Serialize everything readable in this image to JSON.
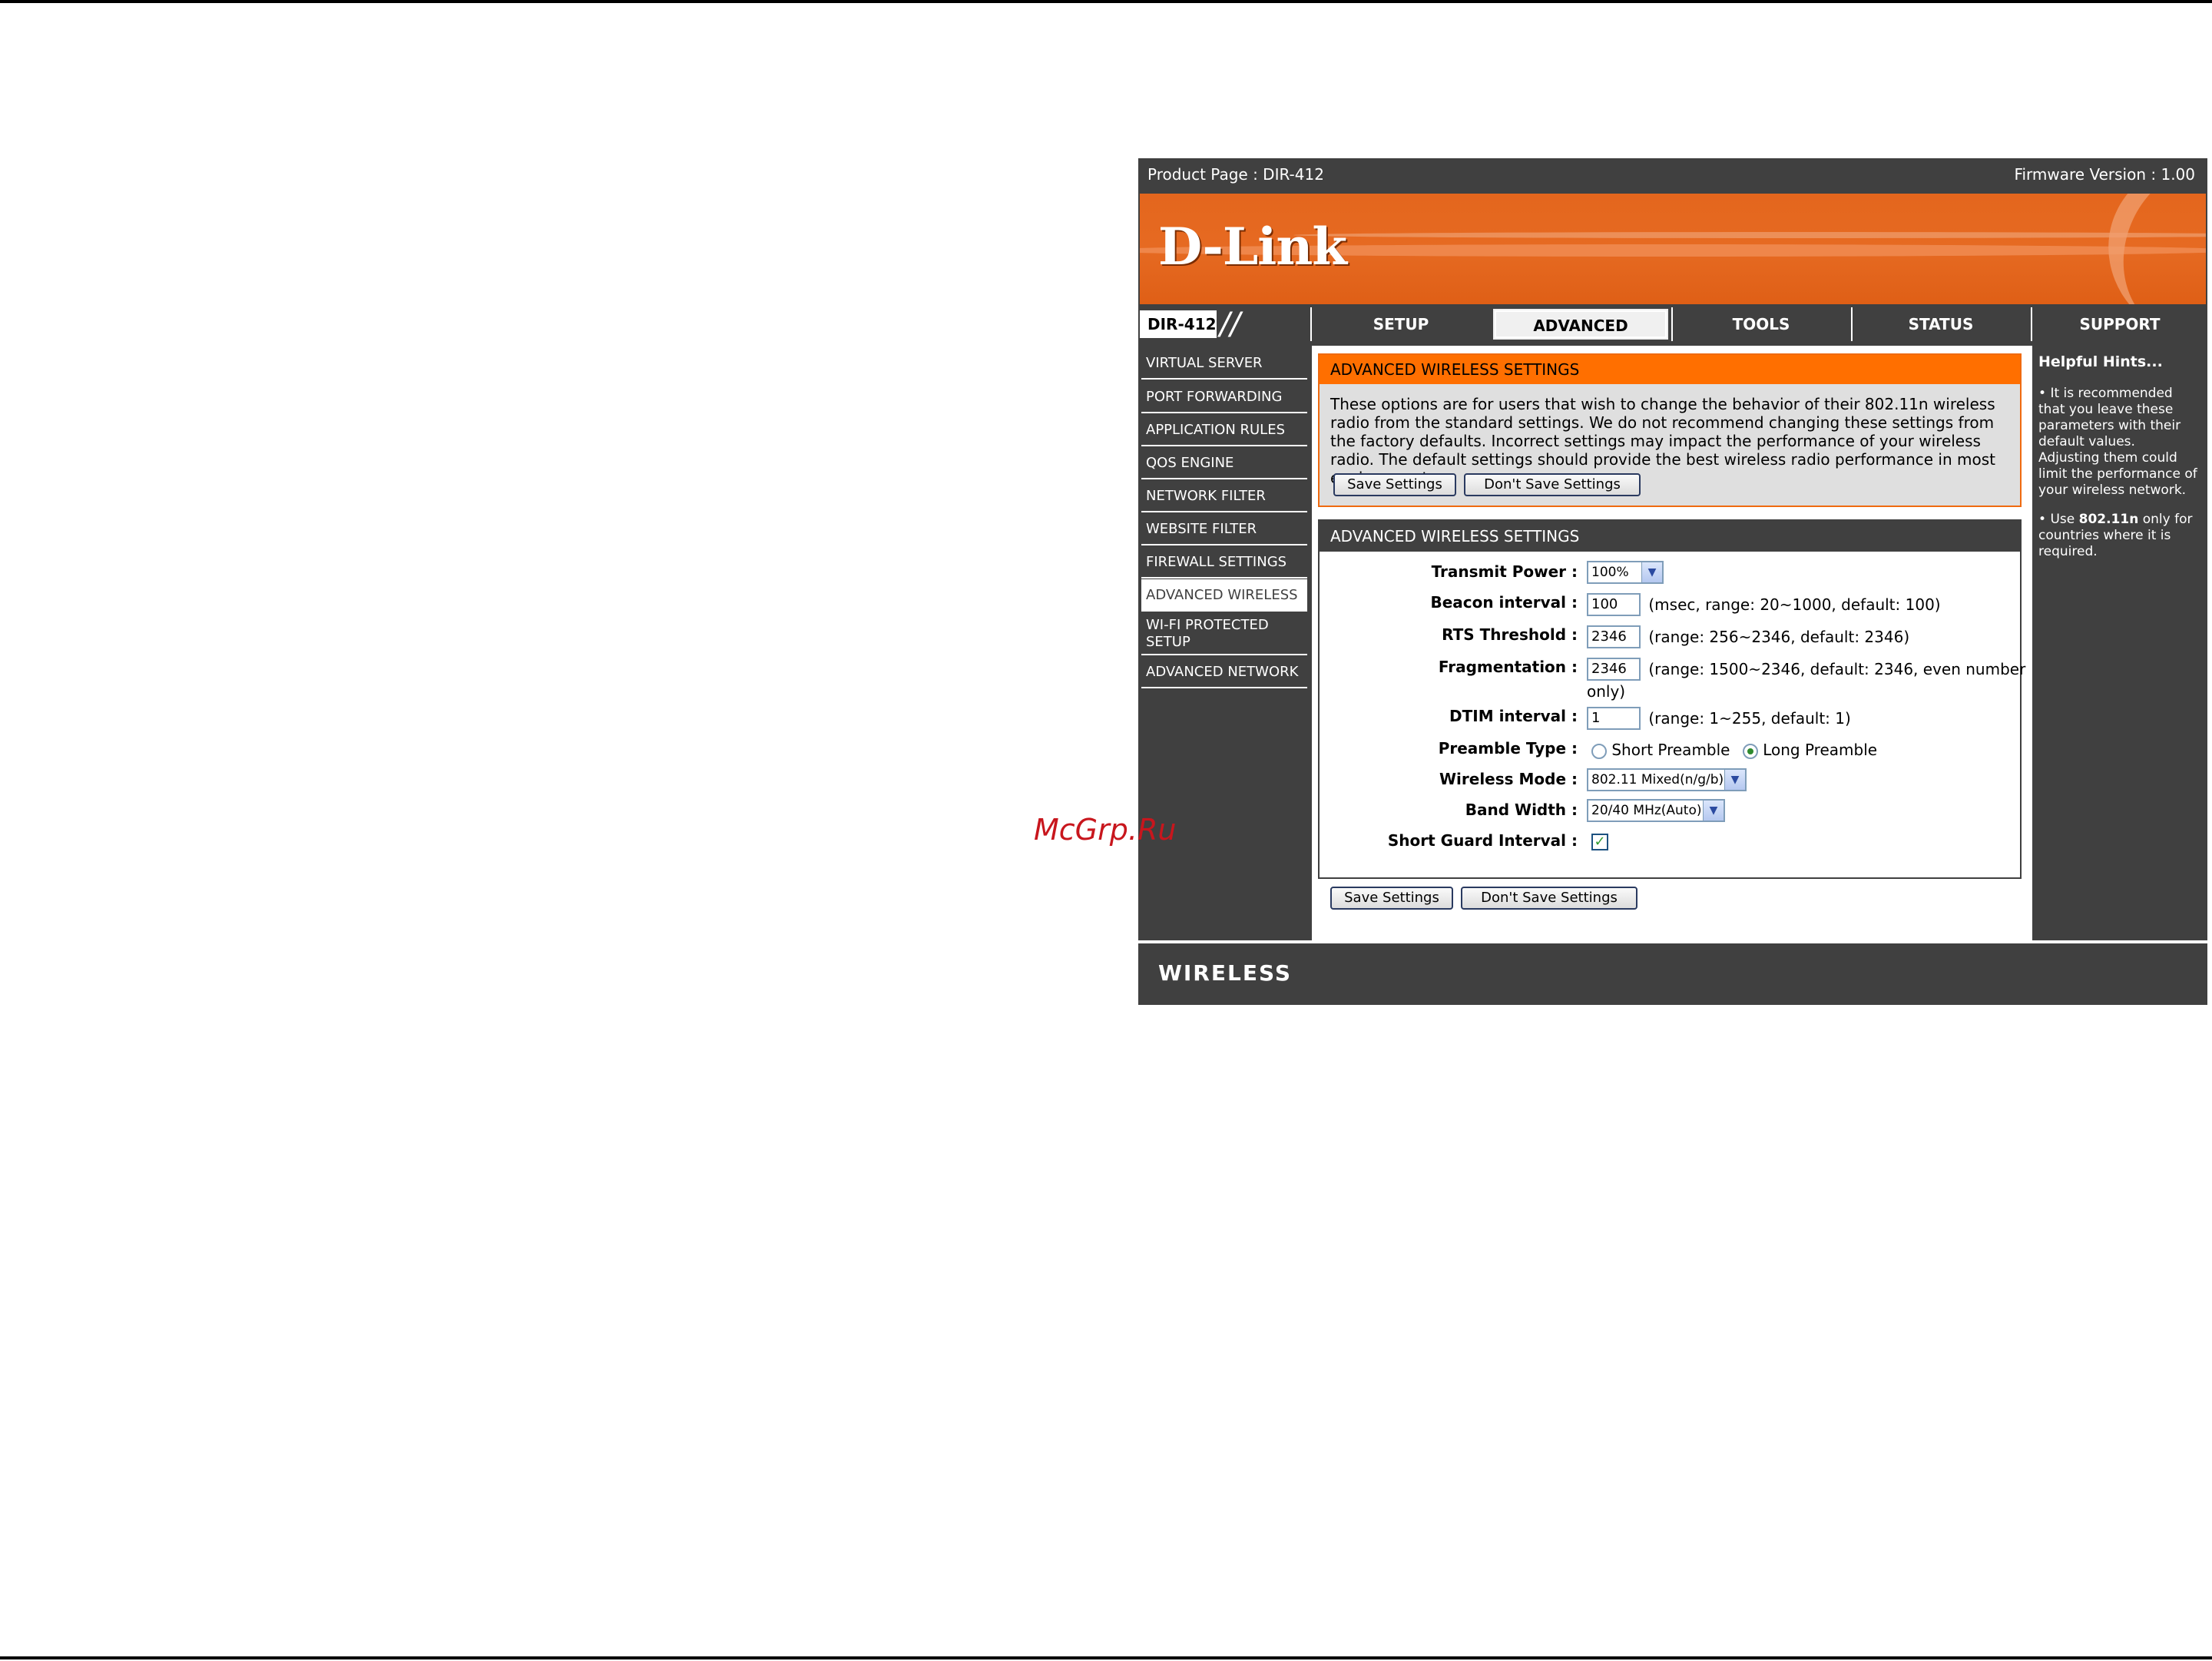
{
  "header": {
    "product": "Product Page : DIR-412",
    "firmware": "Firmware Version : 1.00",
    "logo": "D-Link"
  },
  "nav": {
    "model": "DIR-412",
    "tabs": [
      {
        "label": "SETUP"
      },
      {
        "label": "ADVANCED"
      },
      {
        "label": "TOOLS"
      },
      {
        "label": "STATUS"
      },
      {
        "label": "SUPPORT"
      }
    ],
    "active_tab": "ADVANCED"
  },
  "sidebar": {
    "items": [
      {
        "label": "VIRTUAL SERVER"
      },
      {
        "label": "PORT FORWARDING"
      },
      {
        "label": "APPLICATION RULES"
      },
      {
        "label": "QOS ENGINE"
      },
      {
        "label": "NETWORK FILTER"
      },
      {
        "label": "WEBSITE FILTER"
      },
      {
        "label": "FIREWALL SETTINGS"
      },
      {
        "label": "ADVANCED WIRELESS"
      },
      {
        "label": "WI-FI PROTECTED SETUP"
      },
      {
        "label": "ADVANCED NETWORK"
      }
    ],
    "active": "ADVANCED WIRELESS"
  },
  "intro": {
    "title": "ADVANCED WIRELESS SETTINGS",
    "description": "These options are for users that wish to change the behavior of their 802.11n wireless radio from the standard settings. We do not recommend changing these settings from the factory defaults. Incorrect settings may impact the performance of your wireless radio. The default settings should provide the best wireless radio performance in most environments.",
    "save_label": "Save Settings",
    "dont_save_label": "Don't Save Settings"
  },
  "settings": {
    "title": "ADVANCED WIRELESS SETTINGS",
    "transmit_power": {
      "label": "Transmit Power :",
      "value": "100%"
    },
    "beacon_interval": {
      "label": "Beacon interval :",
      "value": "100",
      "hint": "(msec, range: 20~1000, default: 100)"
    },
    "rts_threshold": {
      "label": "RTS Threshold :",
      "value": "2346",
      "hint": "(range: 256~2346, default: 2346)"
    },
    "fragmentation": {
      "label": "Fragmentation :",
      "value": "2346",
      "hint": "(range: 1500~2346, default: 2346, even number",
      "hint2": "only)"
    },
    "dtim_interval": {
      "label": "DTIM interval :",
      "value": "1",
      "hint": "(range: 1~255, default: 1)"
    },
    "preamble_type": {
      "label": "Preamble Type :",
      "options": [
        "Short Preamble",
        "Long Preamble"
      ],
      "selected": "Long Preamble"
    },
    "wireless_mode": {
      "label": "Wireless Mode :",
      "value": "802.11 Mixed(n/g/b)"
    },
    "band_width": {
      "label": "Band Width :",
      "value": "20/40 MHz(Auto)"
    },
    "short_guard_interval": {
      "label": "Short Guard Interval :",
      "checked": true
    }
  },
  "bottom_buttons": {
    "save_label": "Save Settings",
    "dont_save_label": "Don't Save Settings"
  },
  "hints": {
    "title": "Helpful Hints...",
    "hint1": "It is recommended that you leave these parameters with their default values. Adjusting them could limit the performance of your wireless network.",
    "hint2_pre": "Use",
    "hint2_bold": "802.11n",
    "hint2_post": "only for countries where it is required."
  },
  "footer": {
    "brand": "WIRELESS"
  },
  "watermark": "McGrp.Ru",
  "colors": {
    "orange": "#ff6f00",
    "dark": "#404040",
    "accent_border": "#ef6a10"
  }
}
